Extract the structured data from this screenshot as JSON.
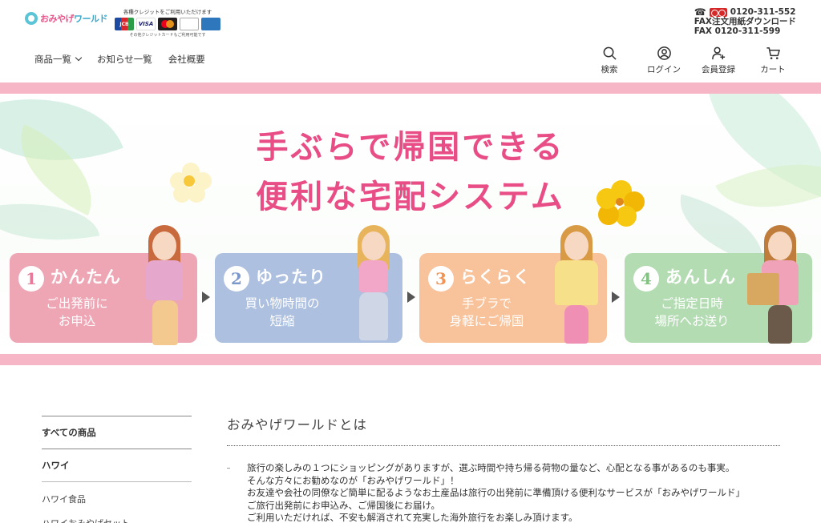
{
  "header": {
    "logo_text_a": "おみやげ",
    "logo_text_b": "ワールド",
    "credit_top": "各種クレジットをご利用いただけます",
    "credit_cards": [
      "JCB",
      "VISA",
      "mastercard",
      "Diners Club",
      "AMERICAN EXPRESS"
    ],
    "credit_bottom": "その他クレジットカードもご利用可能です",
    "phone": "0120-311-552",
    "fax_download": "FAX注文用紙ダウンロード",
    "fax": "FAX 0120-311-599"
  },
  "nav": {
    "items": [
      "商品一覧",
      "お知らせ一覧",
      "会社概要"
    ]
  },
  "toolbar": {
    "search": "検索",
    "login": "ログイン",
    "register": "会員登録",
    "cart": "カート"
  },
  "banner": {
    "line1": "手ぶらで帰国できる",
    "line2": "便利な宅配システム",
    "steps": [
      {
        "num": "1",
        "title": "かんたん",
        "desc1": "ご出発前に",
        "desc2": "お申込"
      },
      {
        "num": "2",
        "title": "ゆったり",
        "desc1": "買い物時間の",
        "desc2": "短縮"
      },
      {
        "num": "3",
        "title": "らくらく",
        "desc1": "手ブラで",
        "desc2": "身軽にご帰国"
      },
      {
        "num": "4",
        "title": "あんしん",
        "desc1": "ご指定日時",
        "desc2": "場所へお送り"
      }
    ],
    "colors": {
      "pink": "#eea5b4",
      "blue": "#adc0e0",
      "orange": "#f8c29a",
      "green": "#b4dcb3",
      "headline": "#e84d85"
    }
  },
  "sidebar": {
    "all_products": "すべての商品",
    "hawaii": "ハワイ",
    "items": [
      "ハワイ食品",
      "ハワイおみやげセット"
    ]
  },
  "main": {
    "title": "おみやげワールドとは",
    "lines": [
      "旅行の楽しみの１つにショッピングがありますが、選ぶ時間や持ち帰る荷物の量など、心配となる事があるのも事実。",
      "そんな方々にお勧めなのが「おみやげワールド」！",
      "お友達や会社の同僚など簡単に配るようなお土産品は旅行の出発前に準備頂ける便利なサービスが「おみやげワールド」",
      "ご旅行出発前にお申込み、ご帰国後にお届け。",
      "ご利用いただければ、不安も解消されて充実した海外旅行をお楽しみ頂けます。"
    ]
  }
}
